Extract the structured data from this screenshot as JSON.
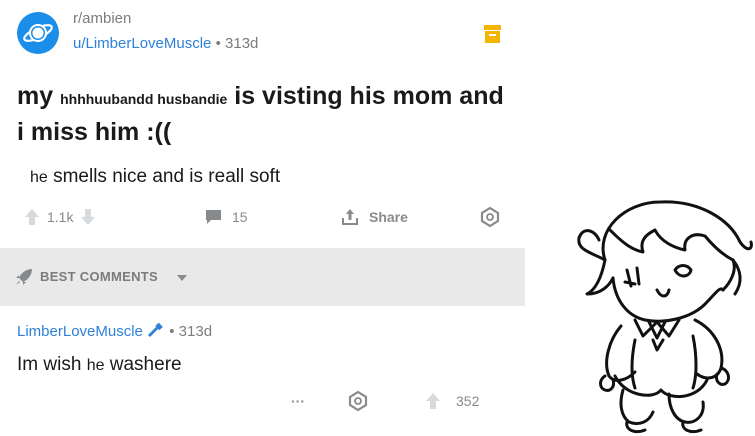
{
  "post": {
    "subreddit": "r/ambien",
    "author": "u/LimberLoveMuscle",
    "separator": "•",
    "age": "313d",
    "title_part1": "my",
    "title_small": "hhhhuubandd husbandie",
    "title_part2": "is visting his  mom and i miss him :((",
    "body_he": "he",
    "body_rest": "smells nice and is reall soft",
    "upvotes": "1.1k",
    "comments_count": "15",
    "share_label": "Share"
  },
  "sort": {
    "label": "BEST COMMENTS"
  },
  "comment": {
    "author": "LimberLoveMuscle",
    "separator": "•",
    "age": "313d",
    "text_pre": "Im wish",
    "text_he": "he",
    "text_post": "washere",
    "more": "···",
    "score": "352"
  },
  "colors": {
    "link_blue": "#2f80d8",
    "meta_gray": "#7c7c7c",
    "save_yellow": "#f5b400",
    "avatar_blue": "#1a8ee8",
    "sort_bar_bg": "#e9e9ea"
  },
  "icons": [
    "planet-icon",
    "save-icon",
    "upvote-icon",
    "downvote-icon",
    "comment-icon",
    "share-icon",
    "award-icon",
    "rocket-icon",
    "chevron-down-icon"
  ]
}
